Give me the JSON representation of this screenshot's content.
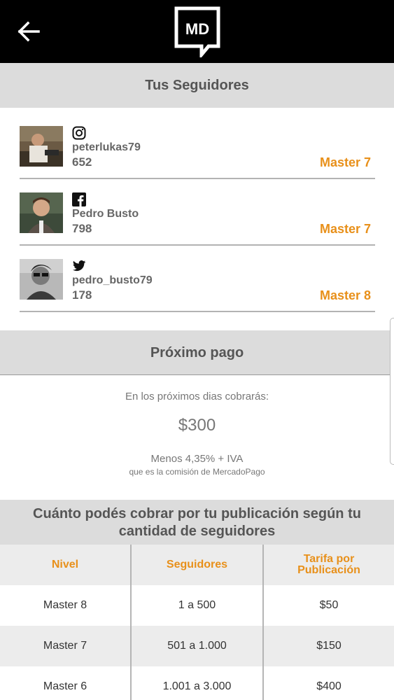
{
  "header": {
    "logo_text": "MD",
    "back_icon": "arrow-left-icon"
  },
  "followers_section": {
    "title": "Tus Seguidores",
    "items": [
      {
        "network": "instagram",
        "icon": "instagram-icon",
        "name": "peterlukas79",
        "count": "652",
        "level": "Master 7"
      },
      {
        "network": "facebook",
        "icon": "facebook-icon",
        "name": "Pedro Busto",
        "count": "798",
        "level": "Master 7"
      },
      {
        "network": "twitter",
        "icon": "twitter-icon",
        "name": "pedro_busto79",
        "count": "178",
        "level": "Master 8"
      }
    ]
  },
  "payment_section": {
    "title": "Próximo pago",
    "intro": "En los próximos dias cobrarás:",
    "amount": "$300",
    "fee": "Menos 4,35% + IVA",
    "fee_note": "que es la comisión de MercadoPago"
  },
  "rates_section": {
    "title_line1": "Cuánto podés cobrar por tu publicación según tu",
    "title_line2": "cantidad de seguidores",
    "columns": [
      "Nivel",
      "Seguidores",
      "Tarifa por",
      "Publicación"
    ],
    "rows": [
      {
        "level": "Master 8",
        "followers": "1 a 500",
        "rate": "$50"
      },
      {
        "level": "Master 7",
        "followers": "501 a 1.000",
        "rate": "$150"
      },
      {
        "level": "Master 6",
        "followers": "1.001 a 3.000",
        "rate": "$400"
      }
    ]
  },
  "colors": {
    "accent": "#e8901a",
    "header_bg": "#000000",
    "section_bg": "#dcdcdc",
    "row_alt_bg": "#ececec"
  }
}
